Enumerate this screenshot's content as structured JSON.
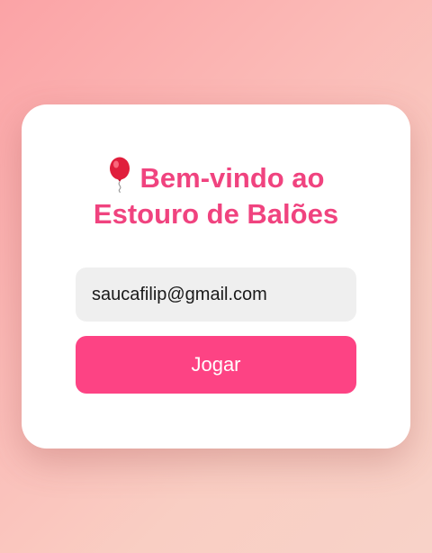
{
  "welcome": {
    "icon": "balloon-icon",
    "title_line1": "Bem-vindo ao",
    "title_line2": "Estouro de Balões"
  },
  "login": {
    "email_value": "saucafilip@gmail.com",
    "play_label": "Jogar"
  },
  "colors": {
    "accent": "#fd4384",
    "title": "#f0437f",
    "input_bg": "#efefef",
    "background": "#fbb4b2"
  }
}
